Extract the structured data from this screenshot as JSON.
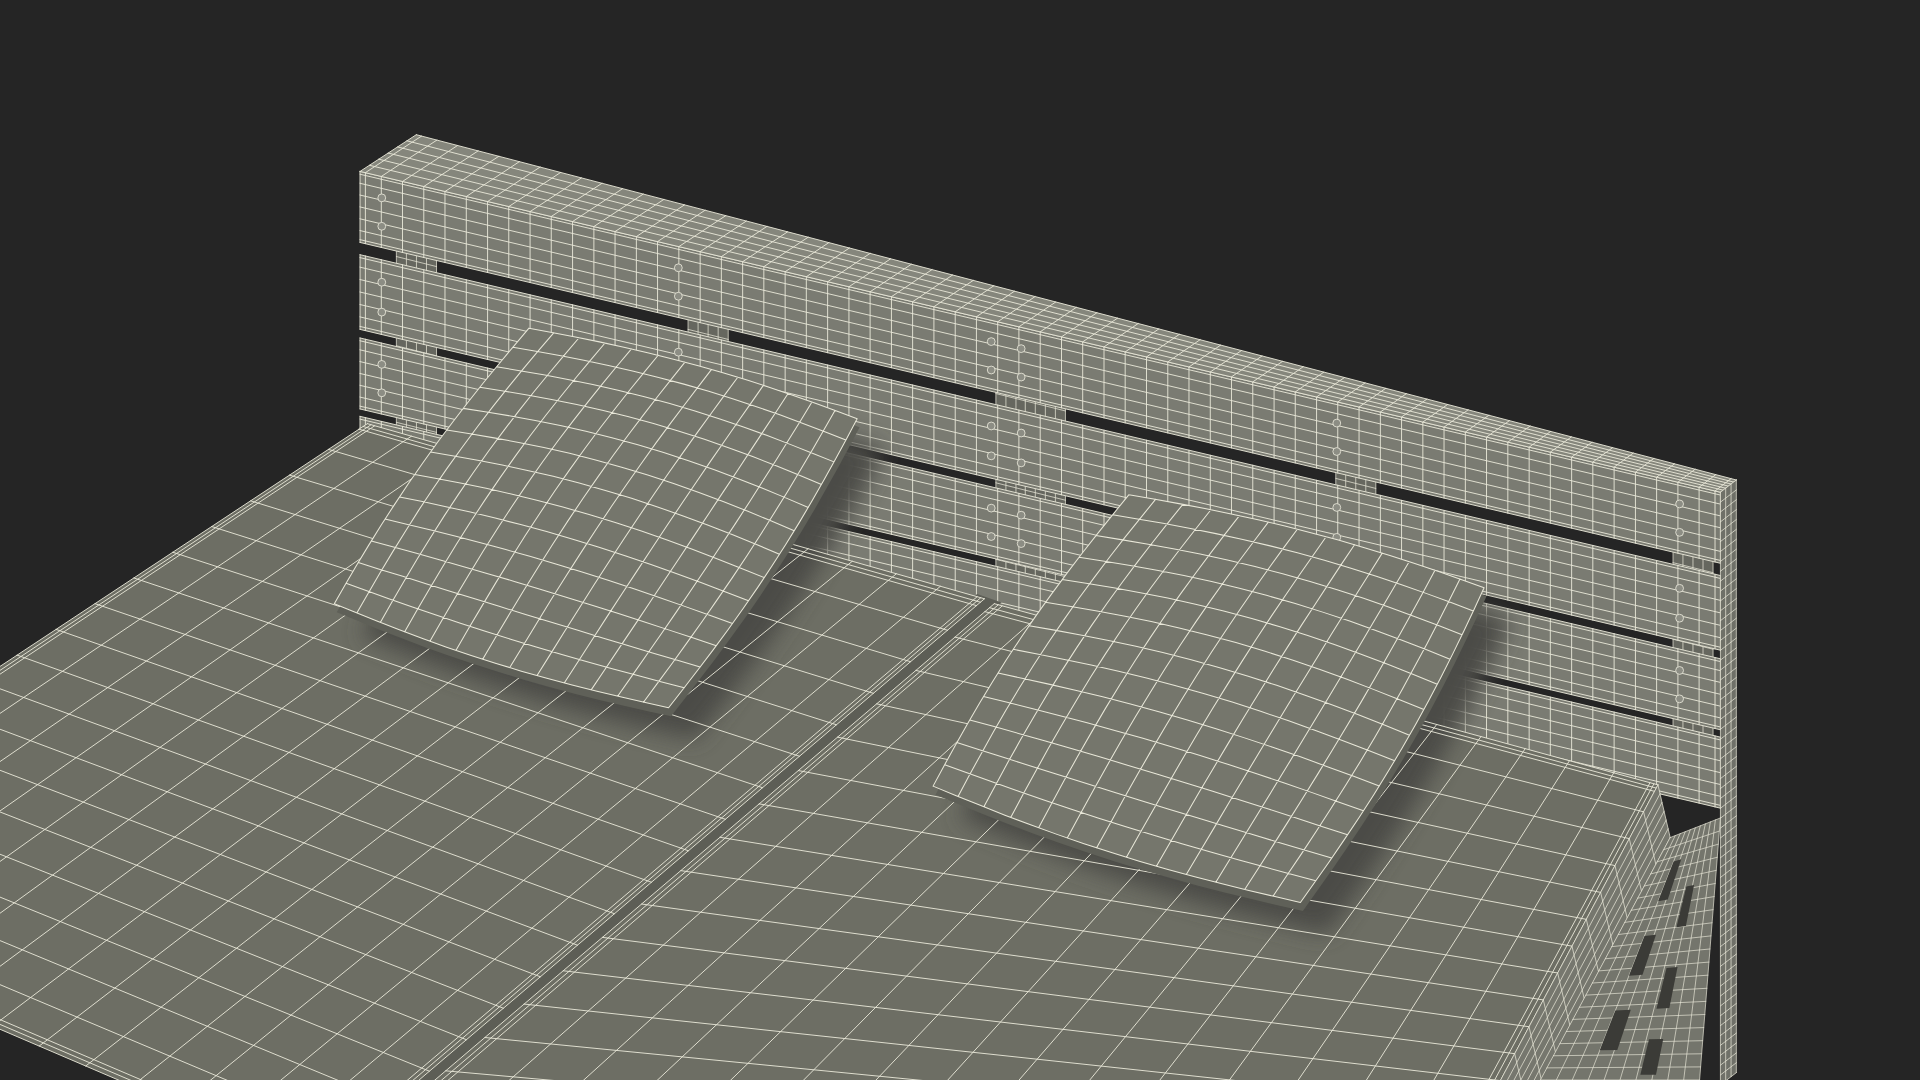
{
  "render": {
    "wireframe": true
  }
}
